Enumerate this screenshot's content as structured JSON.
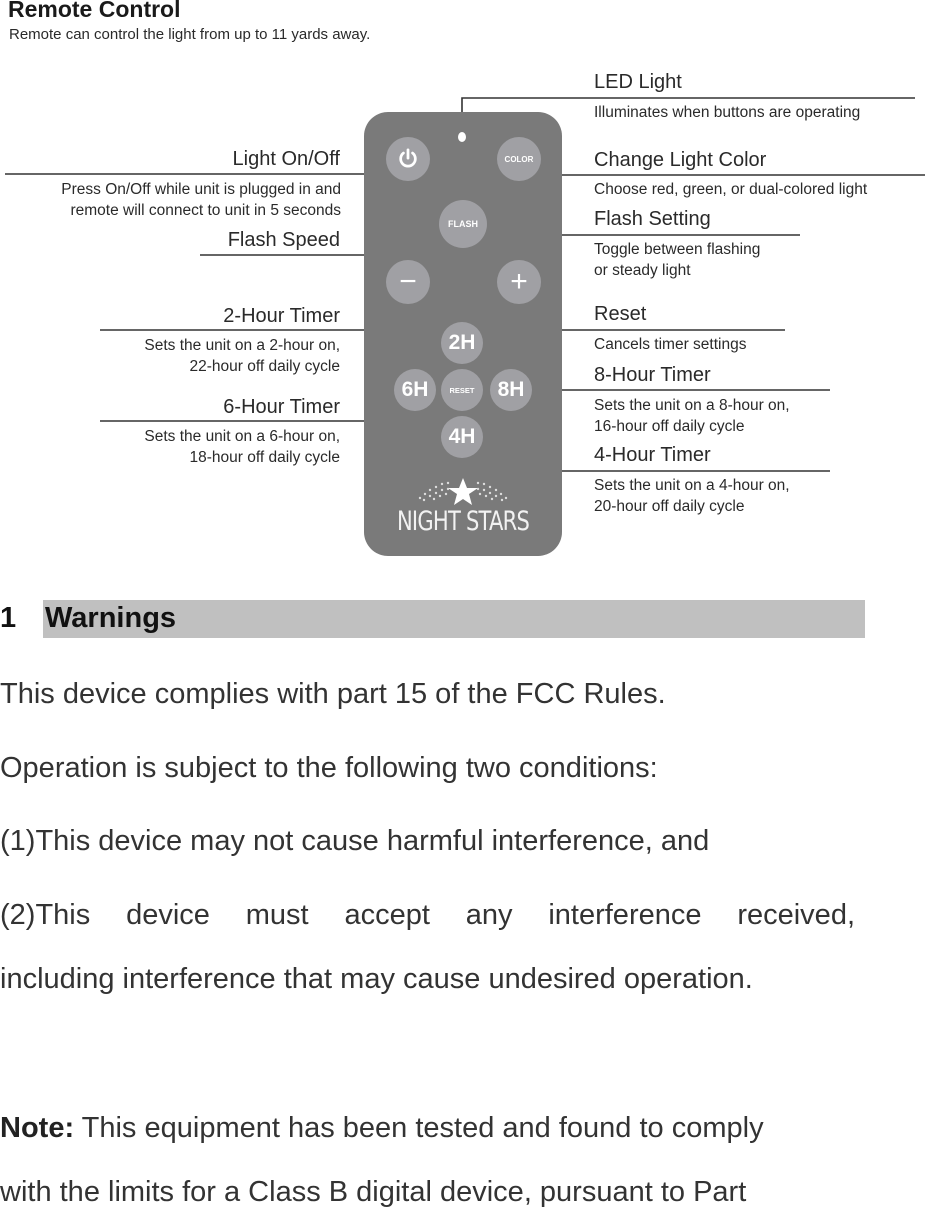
{
  "header": {
    "title": "Remote Control",
    "subtitle": "Remote can control the light from up to 11 yards away."
  },
  "remote": {
    "buttons": {
      "power_icon": "power-icon",
      "color": "COLOR",
      "flash": "FLASH",
      "minus": "−",
      "plus": "+",
      "timer_2h": "2H",
      "timer_6h": "6H",
      "reset": "RESET",
      "timer_8h": "8H",
      "timer_4h": "4H"
    },
    "brand": "NIGHT STARS",
    "colors": {
      "body": "#7a7a7a",
      "button": "#a0a0a4",
      "text": "#ffffff"
    }
  },
  "callouts": {
    "led_light": {
      "title": "LED Light",
      "desc": [
        "Illuminates when buttons are operating"
      ]
    },
    "light_on_off": {
      "title": "Light On/Off",
      "desc": [
        "Press On/Off while unit is plugged in and",
        "remote will connect to unit in 5 seconds"
      ]
    },
    "change_color": {
      "title": "Change Light Color",
      "desc": [
        "Choose red, green, or dual-colored light"
      ]
    },
    "flash_setting": {
      "title": "Flash Setting",
      "desc": [
        "Toggle between flashing",
        "or steady light"
      ]
    },
    "flash_speed": {
      "title": "Flash Speed"
    },
    "timer_2h": {
      "title": "2-Hour Timer",
      "desc": [
        "Sets the unit on a 2-hour on,",
        "22-hour off daily cycle"
      ]
    },
    "reset": {
      "title": "Reset",
      "desc": [
        "Cancels timer settings"
      ]
    },
    "timer_8h": {
      "title": "8-Hour Timer",
      "desc": [
        "Sets the unit on a 8-hour on,",
        "16-hour off daily cycle"
      ]
    },
    "timer_6h": {
      "title": "6-Hour Timer",
      "desc": [
        "Sets the unit on a 6-hour on,",
        "18-hour off daily cycle"
      ]
    },
    "timer_4h": {
      "title": "4-Hour Timer",
      "desc": [
        "Sets the unit on a 4-hour on,",
        "20-hour off daily cycle"
      ]
    }
  },
  "section": {
    "number": "1",
    "title": "Warnings",
    "bar_color": "#c0c0c0"
  },
  "body": {
    "p1": "This device complies with part 15 of the FCC Rules.",
    "p2": "Operation is subject to the following two conditions:",
    "item1_num": "(1)",
    "item1": "This device may not cause harmful interference, and",
    "item2_num": "(2)",
    "item2": "This device must accept any interference received,",
    "item2_cont": "including interference that may cause undesired operation.",
    "note_label": "Note:",
    "note_text": " This equipment has been tested and found to comply",
    "note_cont": "with the limits for a Class B digital device, pursuant to Part"
  }
}
